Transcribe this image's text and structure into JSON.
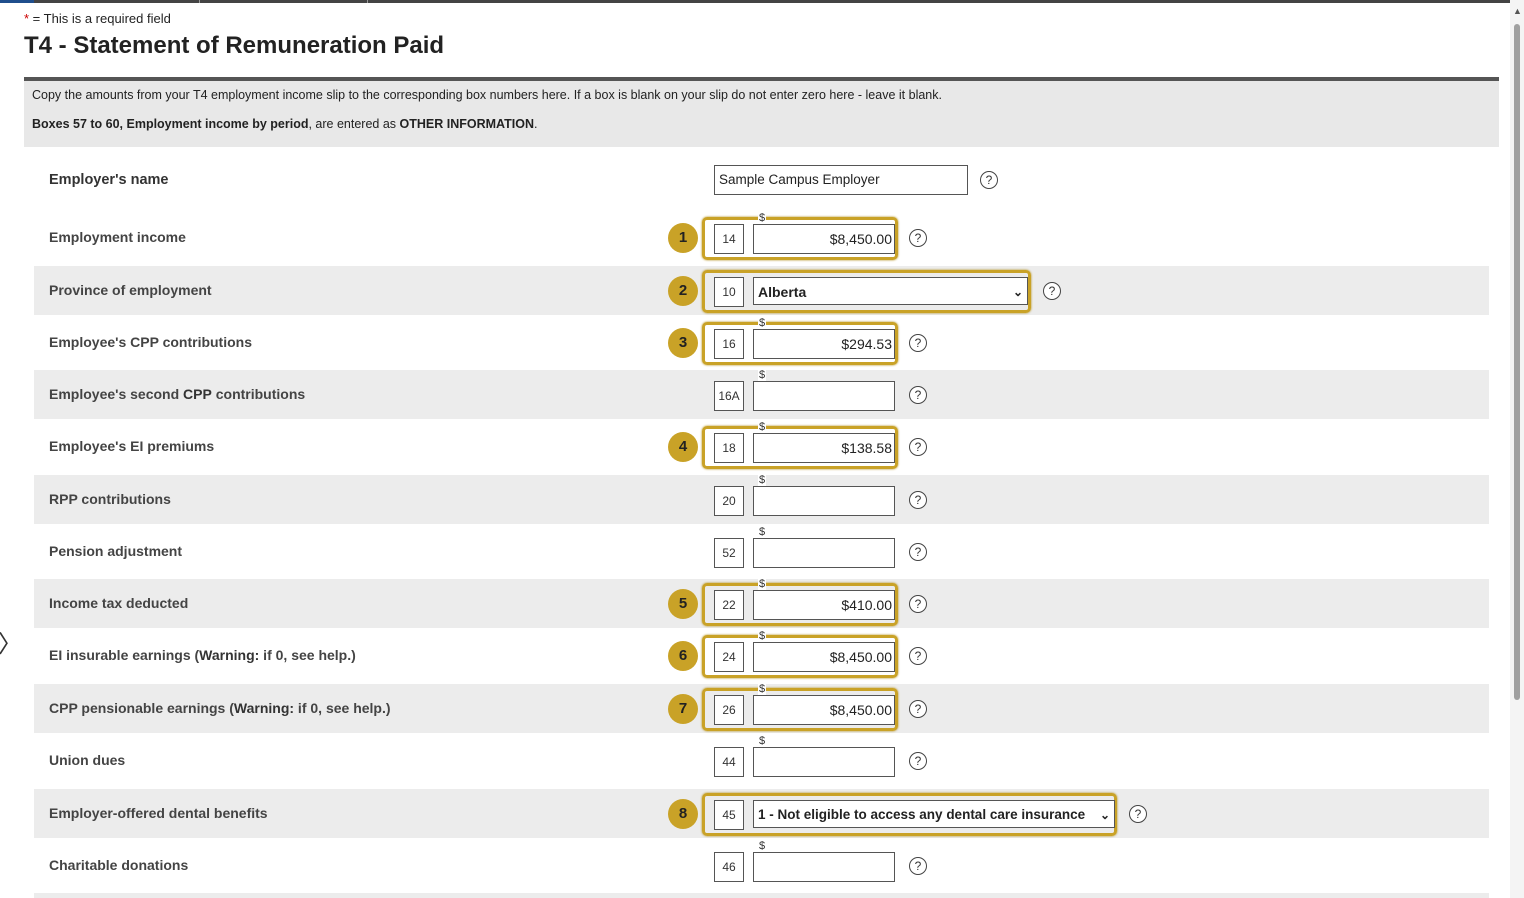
{
  "required_note": {
    "star": "*",
    "text": " = This is a required field"
  },
  "title": "T4 - Statement of Remuneration Paid",
  "info": {
    "line1": "Copy the amounts from your T4 employment income slip to the corresponding box numbers here. If a box is blank on your slip do not enter zero here - leave it blank.",
    "line2_bold": "Boxes 57 to 60, Employment income by period",
    "line2_mid": ", are entered as ",
    "line2_bold2": "OTHER INFORMATION",
    "line2_end": "."
  },
  "employer": {
    "label": "Employer's name",
    "value": "Sample Campus Employer"
  },
  "currency_symbol": "$",
  "help_glyph": "?",
  "rows": [
    {
      "label": "Employment income",
      "box": "14",
      "value": "$8,450.00",
      "badge": "1"
    },
    {
      "label": "Province of employment",
      "box": "10",
      "select": "Alberta",
      "badge": "2"
    },
    {
      "label": "Employee's CPP contributions",
      "box": "16",
      "value": "$294.53",
      "badge": "3"
    },
    {
      "label_pre": "Employee's second ",
      "label_bold": "CPP",
      "label_post": " contributions",
      "box": "16A",
      "value": ""
    },
    {
      "label": "Employee's EI premiums",
      "box": "18",
      "value": "$138.58",
      "badge": "4"
    },
    {
      "label": "RPP contributions",
      "box": "20",
      "value": ""
    },
    {
      "label": "Pension adjustment",
      "box": "52",
      "value": ""
    },
    {
      "label": "Income tax deducted",
      "box": "22",
      "value": "$410.00",
      "badge": "5"
    },
    {
      "label_pre": "EI insurable earnings (",
      "label_bold": "Warning:",
      "label_post": " if 0, see help.)",
      "box": "24",
      "value": "$8,450.00",
      "badge": "6"
    },
    {
      "label_pre": "CPP pensionable earnings (",
      "label_bold": "Warning:",
      "label_post": " if 0, see help.)",
      "box": "26",
      "value": "$8,450.00",
      "badge": "7"
    },
    {
      "label": "Union dues",
      "box": "44",
      "value": ""
    },
    {
      "label": "Employer-offered dental benefits",
      "box": "45",
      "select": "1 - Not eligible to access any dental care insurance",
      "badge": "8"
    },
    {
      "label": "Charitable donations",
      "box": "46",
      "value": ""
    }
  ],
  "colors": {
    "badge": "#c9a227",
    "shaded_row": "#ececec",
    "info_bg": "#e8e8e8"
  },
  "icons": {
    "help": "help-circle-icon",
    "dropdown": "chevron-down-icon"
  }
}
